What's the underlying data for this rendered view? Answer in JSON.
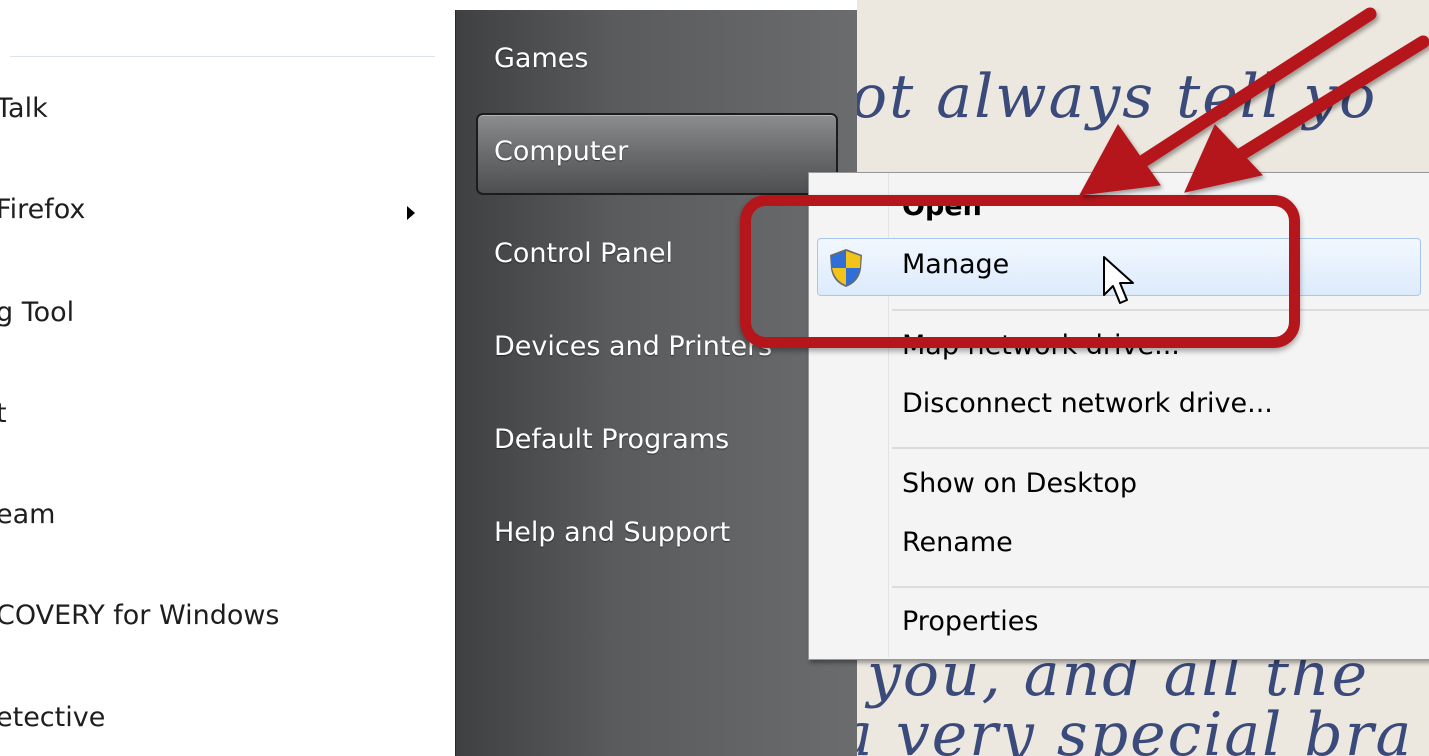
{
  "programs": [
    {
      "label": "Talk",
      "has_submenu": false
    },
    {
      "label": "Firefox",
      "has_submenu": true
    },
    {
      "label": "g Tool",
      "has_submenu": false
    },
    {
      "label": "t",
      "has_submenu": false
    },
    {
      "label": "eam",
      "has_submenu": false
    },
    {
      "label": "COVERY for Windows",
      "has_submenu": false
    },
    {
      "label": "etective",
      "has_submenu": false
    }
  ],
  "start_menu_right": {
    "items": [
      "Games",
      "Computer",
      "Control Panel",
      "Devices and Printers",
      "Default Programs",
      "Help and Support"
    ],
    "selected": "Computer"
  },
  "context_menu": {
    "items": [
      "Open",
      "Manage",
      "Map network drive...",
      "Disconnect network drive...",
      "Show on Desktop",
      "Rename",
      "Properties"
    ],
    "hovered": "Manage",
    "icons": {
      "manage": "uac-shield-icon"
    }
  },
  "wallpaper_text": [
    "ot always tell yo",
    "you, and all the",
    "a very special bra"
  ],
  "annotation": {
    "color": "#b5161b",
    "icons": [
      "callout-box",
      "arrow-icon"
    ]
  },
  "colors": {
    "menu_hover": "#dcebfc",
    "menu_hover_border": "#a9c7ee",
    "start_panel_dark": "#4e4f51"
  }
}
